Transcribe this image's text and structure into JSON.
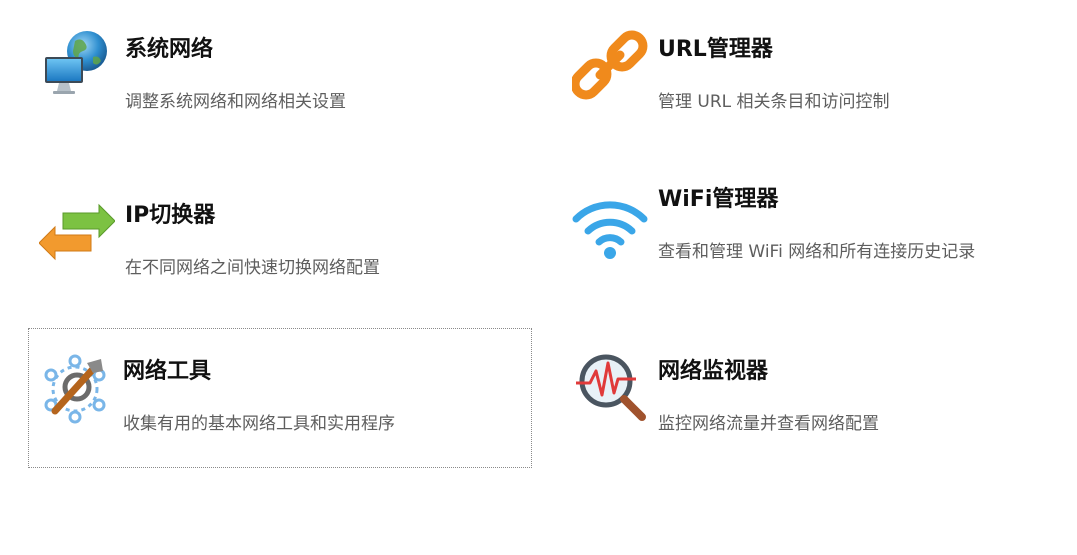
{
  "tiles": [
    {
      "title": "系统网络",
      "desc": "调整系统网络和网络相关设置",
      "icon": "globe-monitor-icon"
    },
    {
      "title": "URL管理器",
      "desc": "管理 URL 相关条目和访问控制",
      "icon": "chain-link-icon"
    },
    {
      "title": "IP切换器",
      "desc": "在不同网络之间快速切换网络配置",
      "icon": "swap-arrows-icon"
    },
    {
      "title": "WiFi管理器",
      "desc": "查看和管理 WiFi 网络和所有连接历史记录",
      "icon": "wifi-icon"
    },
    {
      "title": "网络工具",
      "desc": "收集有用的基本网络工具和实用程序",
      "icon": "network-tools-icon"
    },
    {
      "title": "网络监视器",
      "desc": "监控网络流量并查看网络配置",
      "icon": "monitor-magnifier-icon"
    }
  ],
  "colors": {
    "title": "#111111",
    "description": "#5e5e5e",
    "focus_border": "#8a8a8a",
    "link_orange": "#f08a1c",
    "wifi_blue": "#3aa6e8",
    "arrow_green": "#7cc242",
    "arrow_orange": "#f29a2e"
  }
}
